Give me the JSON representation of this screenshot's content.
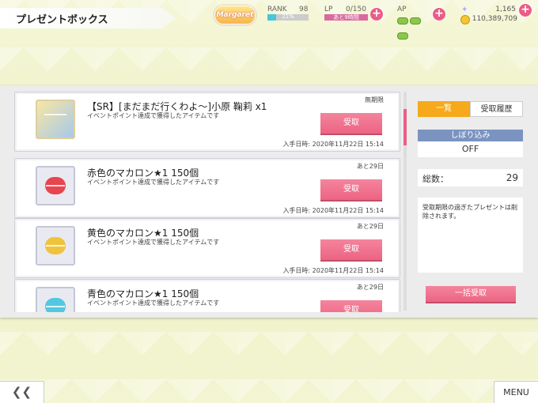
{
  "header": {
    "title": "プレゼントボックス",
    "logo_text": "Margaret",
    "rank_label": "RANK",
    "rank_value": "98",
    "rank_progress": "21%",
    "lp_label": "LP",
    "lp_value": "0/150",
    "lp_sub": "あと9時間",
    "ap_label": "AP",
    "gems": "1,165",
    "coins": "110,389,709"
  },
  "items": [
    {
      "name": "【SR】[まだまだ行くわよ〜]小原 鞠莉 x1",
      "desc": "イベントポイント達成で獲得したアイテムです",
      "limit": "無期限",
      "date": "入手日時: 2020年11月22日 15:14",
      "button": "受取",
      "thumb_color": "#e5cf7c"
    },
    {
      "name": "赤色のマカロン★1 150個",
      "desc": "イベントポイント達成で獲得したアイテムです",
      "limit": "あと29日",
      "date": "入手日時: 2020年11月22日 15:14",
      "button": "受取",
      "thumb_color": "#e8454f"
    },
    {
      "name": "黄色のマカロン★1 150個",
      "desc": "イベントポイント達成で獲得したアイテムです",
      "limit": "あと29日",
      "date": "入手日時: 2020年11月22日 15:14",
      "button": "受取",
      "thumb_color": "#f0c33c"
    },
    {
      "name": "青色のマカロン★1 150個",
      "desc": "イベントポイント達成で獲得したアイテムです",
      "limit": "あと29日",
      "date": "",
      "button": "受取",
      "thumb_color": "#52c8e0"
    }
  ],
  "sidebar": {
    "tab_list": "一覧",
    "tab_history": "受取履歴",
    "filter_label": "しぼり込み",
    "filter_value": "OFF",
    "total_label": "総数：",
    "total_value": "29",
    "note": "受取期限の過ぎたプレゼントは削除されます。",
    "bulk_button": "一括受取"
  },
  "footer": {
    "back_label": "❮❮",
    "menu_label": "MENU"
  },
  "colors": {
    "accent_pink": "#ea5d86",
    "tab_active": "#f6a91a",
    "filter_header": "#7b93c1"
  }
}
